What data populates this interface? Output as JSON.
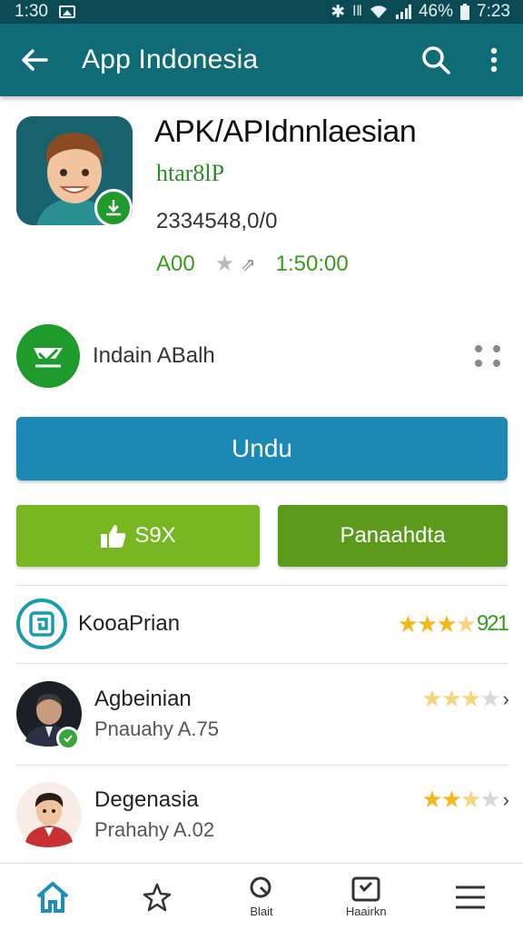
{
  "status_bar": {
    "time_left": "1:30",
    "battery": "46%",
    "time_right": "7:23"
  },
  "app_bar": {
    "title": "App Indonesia"
  },
  "app": {
    "title": "APK/APIdnnlaesian",
    "subtitle": "htar8lP",
    "downloads": "2334548,0/0",
    "meta_left": "A00",
    "meta_right": "1:50:00"
  },
  "developer": {
    "name": "Indain ABalh"
  },
  "buttons": {
    "primary": "Undu",
    "like": "S9X",
    "secondary": "Panaahdta"
  },
  "list": [
    {
      "title": "KooaPrian",
      "rating_text": "921"
    },
    {
      "title": "Agbeinian",
      "subtitle": "Pnauahy A.75"
    },
    {
      "title": "Degenasia",
      "subtitle": "Prahahy A.02"
    }
  ],
  "bottom_nav": [
    {
      "icon": "home-icon",
      "label": ""
    },
    {
      "icon": "pin-icon",
      "label": ""
    },
    {
      "icon": "search-icon",
      "label": "Blait"
    },
    {
      "icon": "inbox-icon",
      "label": "Haairkn"
    },
    {
      "icon": "menu-icon",
      "label": ""
    }
  ],
  "colors": {
    "status_bar": "#0c4a53",
    "app_bar": "#0f6b75",
    "primary_button": "#1b88b5",
    "like_button": "#76b722",
    "secondary_button": "#5b9a1a",
    "star": "#f2b81c",
    "accent_green": "#3a9a1f"
  }
}
